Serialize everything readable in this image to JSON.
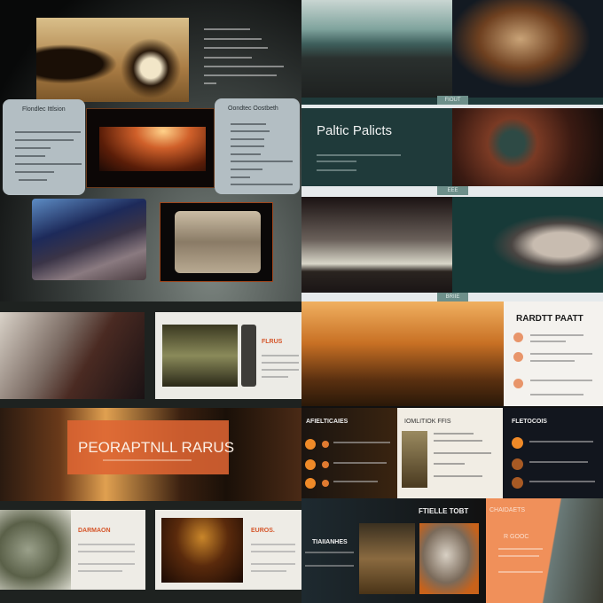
{
  "quadrant_top_left": {
    "card_left_title": "Flondlec Ittlsion",
    "card_right_title": "Oondtec Oostbeth"
  },
  "quadrant_top_right": {
    "tags": [
      "FIOUT",
      "EEE",
      "BRIIE"
    ],
    "title": "Paltic Palicts"
  },
  "quadrant_bottom_left": {
    "slide1_title": "FLRUS",
    "banner_title": "PEORAPTNLL RARUS",
    "slide3_title": "DARMAON",
    "slide4_title": "EUROS."
  },
  "quadrant_bottom_right": {
    "top_title": "RARDTT PAATT",
    "panel1_title": "AFIELTICAIES",
    "panel2_title": "IOMLITIOK FFIS",
    "panel3_title": "FLETOCOIS",
    "bottom_title": "FTIELLE TOBT",
    "bottom_subtitle": "TIAIIANHES",
    "orange_title": "CHAIDAETS",
    "orange_subtitle": "R GOOC"
  },
  "colors": {
    "accent_orange": "#e8874a",
    "teal": "#1f3a3a",
    "card": "#b3bec3"
  }
}
